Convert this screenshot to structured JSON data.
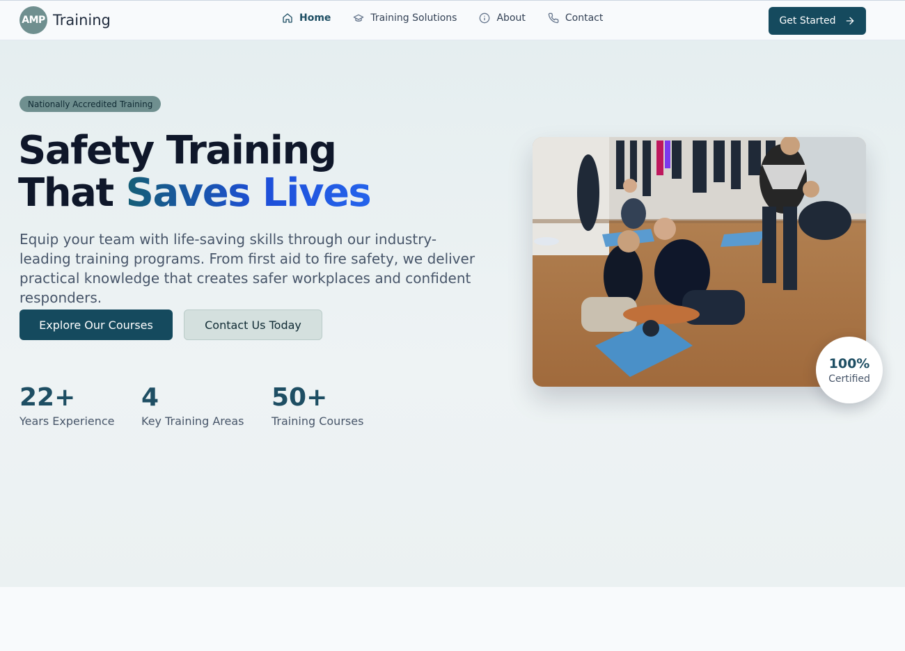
{
  "header": {
    "logo_badge": "AMP",
    "logo_text": "Training",
    "nav": [
      {
        "label": "Home",
        "icon": "home-icon",
        "active": true
      },
      {
        "label": "Training Solutions",
        "icon": "graduation-cap-icon",
        "active": false
      },
      {
        "label": "About",
        "icon": "info-icon",
        "active": false
      },
      {
        "label": "Contact",
        "icon": "phone-icon",
        "active": false
      }
    ],
    "cta_label": "Get Started",
    "cta_icon": "arrow-right-icon"
  },
  "hero": {
    "badge": "Nationally Accredited Training",
    "headline_line1": "Safety Training",
    "headline_line2_prefix": "That ",
    "headline_line2_highlight": "Saves Lives",
    "subtitle": "Equip your team with life-saving skills through our industry-leading training programs. From first aid to fire safety, we deliver practical knowledge that creates safer workplaces and confident responders.",
    "primary_button": "Explore Our Courses",
    "secondary_button": "Contact Us Today",
    "stats": [
      {
        "value": "22+",
        "label": "Years Experience"
      },
      {
        "value": "4",
        "label": "Key Training Areas"
      },
      {
        "value": "50+",
        "label": "Training Courses"
      }
    ],
    "image_alt": "people practicing CPR on training mannequins",
    "certified_value": "100%",
    "certified_label": "Certified"
  },
  "colors": {
    "brand": "#154a5e",
    "accent_blue": "#2563eb",
    "badge_bg": "#6f8f8f"
  }
}
